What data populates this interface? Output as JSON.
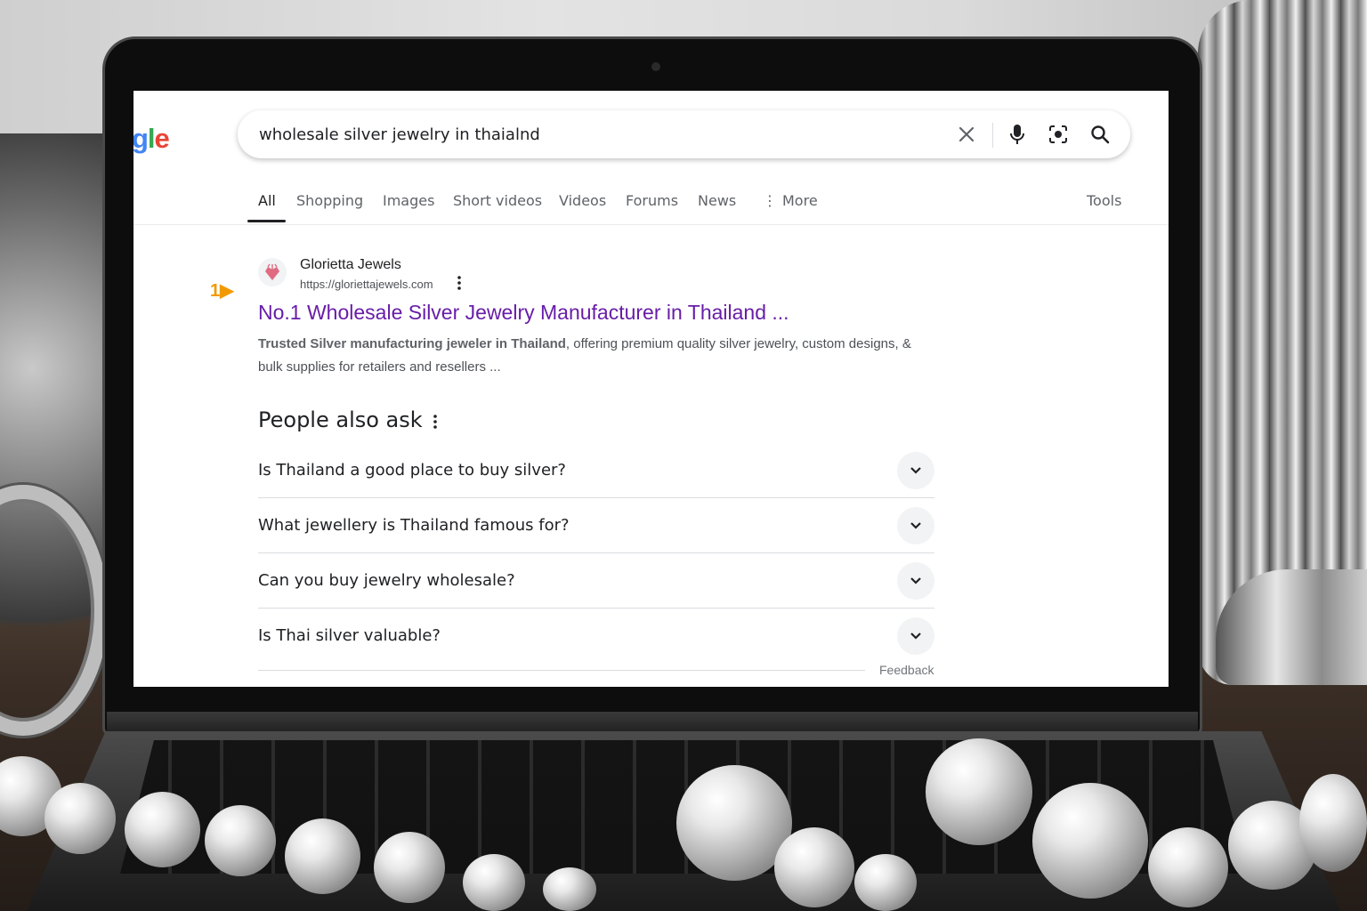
{
  "search": {
    "query": "wholesale silver jewelry in thaialnd"
  },
  "logo": {
    "visible_text": "ogle"
  },
  "tabs": [
    {
      "label": "All",
      "active": true
    },
    {
      "label": "Shopping"
    },
    {
      "label": "Images"
    },
    {
      "label": "Short videos"
    },
    {
      "label": "Videos"
    },
    {
      "label": "Forums"
    },
    {
      "label": "News"
    },
    {
      "label": "More"
    }
  ],
  "tools_label": "Tools",
  "rank_marker": "1",
  "result": {
    "site_name": "Glorietta Jewels",
    "url": "https://gloriettajewels.com",
    "title": "No.1 Wholesale Silver Jewelry Manufacturer in Thailand ...",
    "snippet_bold": "Trusted Silver manufacturing jeweler in Thailand",
    "snippet_rest": ", offering premium quality silver jewelry, custom designs, & bulk supplies for retailers and resellers ..."
  },
  "people_also_ask": {
    "title": "People also ask",
    "questions": [
      "Is Thailand a good place to buy silver?",
      "What jewellery is Thailand famous for?",
      "Can you buy jewelry wholesale?",
      "Is Thai silver valuable?"
    ]
  },
  "feedback_label": "Feedback",
  "colors": {
    "visited_link": "#681da8",
    "rank_marker": "#f29900",
    "google_blue": "#4285f4",
    "google_green": "#34a853",
    "google_red": "#ea4335"
  }
}
